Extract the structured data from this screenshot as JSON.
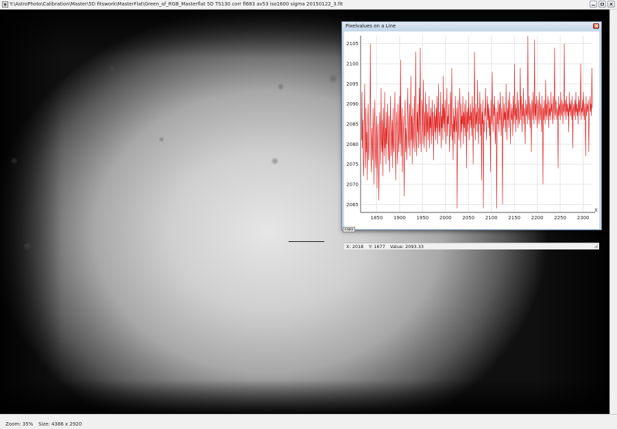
{
  "window": {
    "title": "Y:\\AstroPhoto\\Calibration\\Master\\5D fitswork\\MasterFlat\\Green_of_RGB_Masterflat 5D TS130 corr fl683 av53 iso1600 sigma 20150122_3.fit",
    "icon": "app-icon"
  },
  "status": {
    "zoom": "Zoom: 35%",
    "size": "Size: 4386 x 2920"
  },
  "plot_window": {
    "title": "Pixelvalues on a Line",
    "copy_label": "copy",
    "x_axis_marker": "X",
    "readout": {
      "x": "X: 2018",
      "y": "Y: 1677",
      "value": "Value: 2093.33"
    }
  },
  "colors": {
    "series": "#e02020",
    "grid": "#e4e4e4"
  },
  "chart_data": {
    "type": "line",
    "title": "Pixelvalues on a Line",
    "xlabel": "X",
    "ylabel": "",
    "xlim": [
      1815,
      2320
    ],
    "ylim": [
      2063,
      2107
    ],
    "xticks": [
      1850,
      1900,
      1950,
      2000,
      2050,
      2100,
      2150,
      2200,
      2250,
      2300
    ],
    "yticks": [
      2065,
      2070,
      2075,
      2080,
      2085,
      2090,
      2095,
      2100,
      2105
    ],
    "grid": true,
    "series": [
      {
        "x_start": 1817,
        "x_step": 1,
        "values": [
          2081,
          2093,
          2079,
          2086,
          2076,
          2072,
          2084,
          2095,
          2080,
          2074,
          2089,
          2078,
          2083,
          2071,
          2086,
          2090,
          2076,
          2079,
          2082,
          2087,
          2105,
          2078,
          2073,
          2084,
          2080,
          2076,
          2089,
          2082,
          2070,
          2086,
          2091,
          2078,
          2074,
          2083,
          2087,
          2069,
          2080,
          2085,
          2077,
          2066,
          2079,
          2088,
          2083,
          2075,
          2094,
          2081,
          2078,
          2086,
          2072,
          2089,
          2082,
          2077,
          2093,
          2079,
          2084,
          2075,
          2088,
          2080,
          2085,
          2090,
          2076,
          2081,
          2087,
          2073,
          2079,
          2092,
          2084,
          2077,
          2082,
          2086,
          2074,
          2089,
          2080,
          2078,
          2085,
          2093,
          2081,
          2071,
          2084,
          2088,
          2079,
          2075,
          2090,
          2083,
          2078,
          2086,
          2092,
          2080,
          2101,
          2077,
          2084,
          2089,
          2073,
          2082,
          2087,
          2079,
          2067,
          2085,
          2091,
          2078,
          2084,
          2080,
          2076,
          2088,
          2094,
          2082,
          2079,
          2085,
          2090,
          2077,
          2083,
          2097,
          2081,
          2087,
          2075,
          2089,
          2083,
          2079,
          2086,
          2092,
          2078,
          2084,
          2103,
          2081,
          2077,
          2088,
          2083,
          2090,
          2079,
          2085,
          2094,
          2080,
          2104,
          2086,
          2078,
          2083,
          2091,
          2087,
          2080,
          2096,
          2084,
          2079,
          2088,
          2082,
          2093,
          2086,
          2078,
          2090,
          2083,
          2088,
          2081,
          2085,
          2092,
          2079,
          2087,
          2084,
          2089,
          2080,
          2086,
          2091,
          2082,
          2088,
          2076,
          2085,
          2090,
          2083,
          2087,
          2081,
          2089,
          2084,
          2092,
          2080,
          2086,
          2095,
          2083,
          2088,
          2082,
          2086,
          2093,
          2079,
          2087,
          2084,
          2090,
          2081,
          2097,
          2085,
          2089,
          2083,
          2091,
          2086,
          2080,
          2088,
          2094,
          2082,
          2087,
          2085,
          2090,
          2084,
          2078,
          2088,
          2093,
          2082,
          2086,
          2099,
          2081,
          2085,
          2076,
          2089,
          2083,
          2087,
          2080,
          2092,
          2086,
          2083,
          2089,
          2064,
          2085,
          2091,
          2084,
          2081,
          2088,
          2094,
          2086,
          2079,
          2090,
          2083,
          2087,
          2085,
          2092,
          2080,
          2088,
          2084,
          2090,
          2082,
          2086,
          2091,
          2074,
          2088,
          2083,
          2089,
          2085,
          2093,
          2081,
          2087,
          2086,
          2090,
          2084,
          2088,
          2082,
          2092,
          2086,
          2075,
          2089,
          2084,
          2103,
          2087,
          2081,
          2090,
          2085,
          2088,
          2083,
          2096,
          2086,
          2080,
          2089,
          2085,
          2093,
          2087,
          2082,
          2090,
          2071,
          2088,
          2085,
          2091,
          2064,
          2086,
          2083,
          2089,
          2087,
          2094,
          2085,
          2081,
          2088,
          2092,
          2086,
          2090,
          2084,
          2089,
          2082,
          2087,
          2073,
          2091,
          2085,
          2088,
          2098,
          2086,
          2083,
          2090,
          2087,
          2092,
          2084,
          2080,
          2089,
          2086,
          2064,
          2088,
          2085,
          2091,
          2087,
          2083,
          2090,
          2086,
          2093,
          2088,
          2082,
          2089,
          2085,
          2065,
          2092,
          2087,
          2084,
          2090,
          2086,
          2088,
          2083,
          2095,
          2087,
          2081,
          2089,
          2086,
          2091,
          2084,
          2088,
          2093,
          2085,
          2080,
          2090,
          2087,
          2086,
          2089,
          2082,
          2092,
          2088,
          2085,
          2100,
          2087,
          2090,
          2083,
          2089,
          2086,
          2093,
          2088,
          2084,
          2091,
          2087,
          2085,
          2089,
          2099,
          2086,
          2092,
          2088,
          2083,
          2090,
          2087,
          2094,
          2085,
          2089,
          2086,
          2080,
          2091,
          2088,
          2087,
          2090,
          2085,
          2107,
          2089,
          2086,
          2092,
          2088,
          2084,
          2090,
          2087,
          2078,
          2091,
          2089,
          2086,
          2093,
          2088,
          2085,
          2106,
          2087,
          2090,
          2086,
          2092,
          2089,
          2084,
          2088,
          2091,
          2087,
          2085,
          2093,
          2089,
          2086,
          2090,
          2088,
          2083,
          2092,
          2087,
          2070,
          2089,
          2086,
          2091,
          2088,
          2085,
          2096,
          2087,
          2090,
          2086,
          2089,
          2092,
          2088,
          2084,
          2091,
          2087,
          2089,
          2086,
          2093,
          2088,
          2090,
          2087,
          2085,
          2092,
          2089,
          2086,
          2104,
          2088,
          2087,
          2091,
          2090,
          2086,
          2089,
          2088,
          2074,
          2092,
          2087,
          2090,
          2089,
          2086,
          2093,
          2088,
          2087,
          2091,
          2089,
          2085,
          2090,
          2088,
          2105,
          2087,
          2091,
          2089,
          2086,
          2092,
          2088,
          2090,
          2087,
          2089,
          2083,
          2093,
          2088,
          2090,
          2087,
          2091,
          2089,
          2086,
          2092,
          2079,
          2088,
          2090,
          2087,
          2089,
          2091,
          2086,
          2093,
          2088,
          2090,
          2087,
          2089,
          2085,
          2092,
          2088,
          2091,
          2087,
          2090,
          2100,
          2086,
          2089,
          2088,
          2091,
          2087,
          2093,
          2089,
          2086,
          2090,
          2088,
          2077,
          2092,
          2087,
          2089,
          2090,
          2088,
          2091,
          2078,
          2087,
          2089,
          2092,
          2088,
          2090,
          2087,
          2099,
          2089
        ]
      }
    ]
  }
}
